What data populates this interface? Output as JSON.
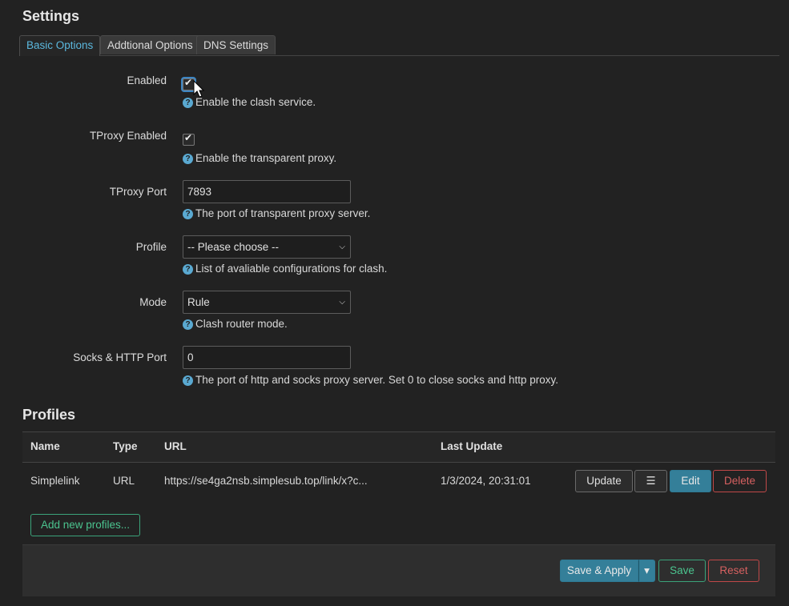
{
  "page": {
    "settings_title": "Settings",
    "profiles_title": "Profiles"
  },
  "tabs": [
    {
      "label": "Basic Options",
      "active": true
    },
    {
      "label": "Addtional Options",
      "active": false
    },
    {
      "label": "DNS Settings",
      "active": false
    }
  ],
  "form": {
    "enabled": {
      "label": "Enabled",
      "checked": true,
      "help": "Enable the clash service."
    },
    "tproxy_enabled": {
      "label": "TProxy Enabled",
      "checked": true,
      "help": "Enable the transparent proxy."
    },
    "tproxy_port": {
      "label": "TProxy Port",
      "value": "7893",
      "help": "The port of transparent proxy server."
    },
    "profile": {
      "label": "Profile",
      "value": "-- Please choose --",
      "help": "List of avaliable configurations for clash."
    },
    "mode": {
      "label": "Mode",
      "value": "Rule",
      "help": "Clash router mode."
    },
    "socks_port": {
      "label": "Socks & HTTP Port",
      "value": "0",
      "help": "The port of http and socks proxy server. Set 0 to close socks and http proxy."
    }
  },
  "profiles_table": {
    "columns": [
      "Name",
      "Type",
      "URL",
      "Last Update"
    ],
    "rows": [
      {
        "name": "Simplelink",
        "type": "URL",
        "url": "https://se4ga2nsb.simplesub.top/link/x?c...",
        "last_update": "1/3/2024, 20:31:01"
      }
    ],
    "actions": {
      "update": "Update",
      "menu": "☰",
      "edit": "Edit",
      "delete": "Delete"
    },
    "add_label": "Add new profiles..."
  },
  "footer": {
    "save_apply": "Save & Apply",
    "dropdown": "▾",
    "save": "Save",
    "reset": "Reset"
  },
  "icons": {
    "help": "?",
    "check": "✔",
    "chevron": "⌵"
  },
  "colors": {
    "accent": "#347f99",
    "active_tab_text": "#5bb8de",
    "positive": "#4bc48f",
    "negative": "#d56060"
  }
}
